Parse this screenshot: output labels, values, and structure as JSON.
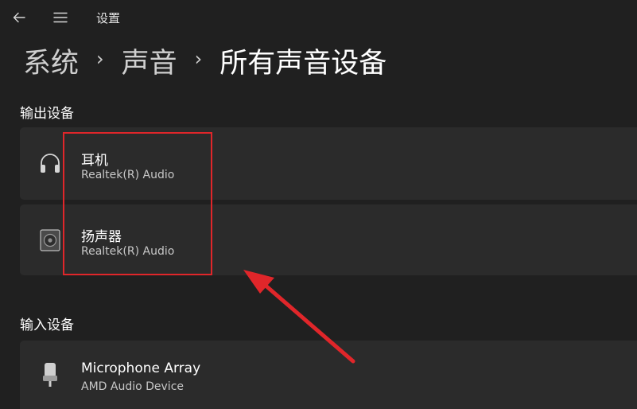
{
  "titlebar": {
    "back_icon": "arrow-left-icon",
    "menu_icon": "hamburger-menu-icon",
    "title": "设置"
  },
  "breadcrumb": {
    "items": [
      "系统",
      "声音",
      "所有声音设备"
    ],
    "separator": "›"
  },
  "output_section": {
    "title": "输出设备",
    "devices": [
      {
        "name": "耳机",
        "subtitle": "Realtek(R) Audio",
        "icon": "headphones-icon"
      },
      {
        "name": "扬声器",
        "subtitle": "Realtek(R) Audio",
        "icon": "speaker-icon"
      }
    ]
  },
  "input_section": {
    "title": "输入设备",
    "devices": [
      {
        "name": "Microphone Array",
        "subtitle": "AMD Audio Device",
        "icon": "microphone-icon"
      }
    ]
  },
  "annotation": {
    "color": "#e0262a"
  },
  "colors": {
    "background": "#202020",
    "card": "#2b2b2b"
  }
}
